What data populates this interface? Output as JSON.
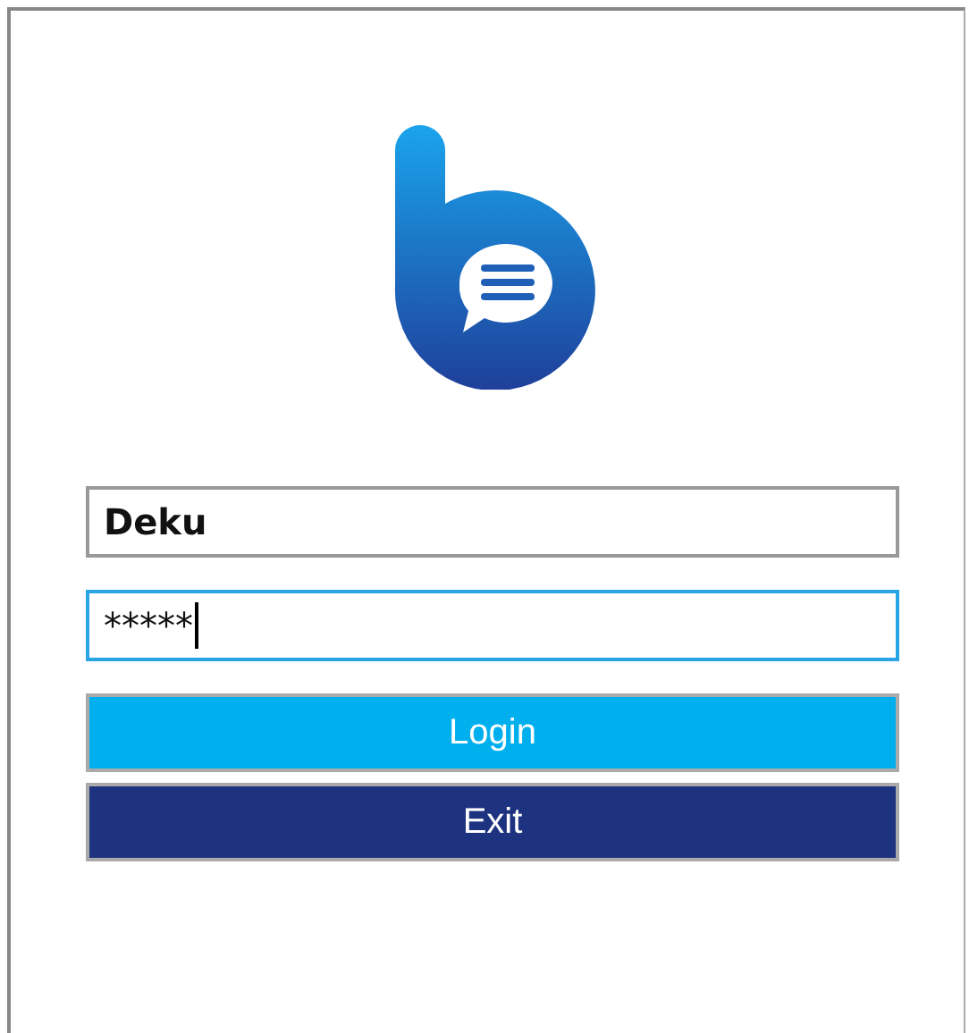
{
  "fields": [
    {
      "kind": "text",
      "value": "Deku",
      "focused": false
    },
    {
      "kind": "password",
      "value": "*****",
      "focused": true
    }
  ],
  "buttons": [
    {
      "label": "Login",
      "kind": "primary"
    },
    {
      "label": "Exit",
      "kind": "secondary"
    }
  ]
}
